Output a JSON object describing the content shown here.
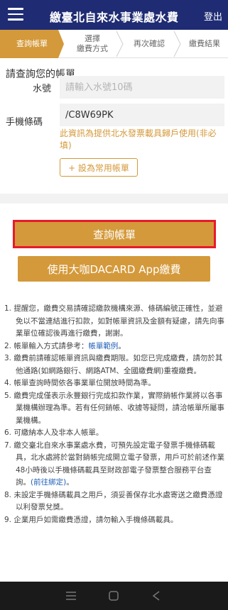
{
  "header": {
    "title": "繳臺北自來水事業處水費",
    "logout_label": "登出"
  },
  "steps": [
    {
      "label": "查詢帳單",
      "active": true
    },
    {
      "label": "選擇\n繳費方式",
      "active": false
    },
    {
      "label": "再次確認",
      "active": false
    },
    {
      "label": "繳費結果",
      "active": false
    }
  ],
  "form": {
    "section_title": "請查詢您的帳單",
    "water_no_label": "水號",
    "water_no_placeholder": "請輸入水號10碼",
    "water_no_value": "",
    "phone_barcode_label": "手機條碼",
    "phone_barcode_value": "/C8W69PK",
    "phone_barcode_note": "此資訊為提供北水發票載具歸戶使用(非必填)",
    "favorite_button_label": "+ 設為常用帳單"
  },
  "actions": {
    "query_label": "查詢帳單",
    "dacard_label": "使用大咖DACARD App繳費"
  },
  "notices": [
    {
      "text": "1. 提醒您，繳費交易請確認繳款機構來源、條碼編號正確性，並避免以不當連結進行扣款，如對帳單資訊及金額有疑慮，請先向事業單位確認後再進行繳費，謝謝。"
    },
    {
      "text": "2. 帳單輸入方式請參考：",
      "link": "帳單範例",
      "after": "。"
    },
    {
      "text": "3. 繳費前請確認帳單資訊與繳費期限。如您已完成繳費，請勿於其他通路(如網路銀行、網路ATM、全國繳費網)重複繳費。"
    },
    {
      "text": "4. 帳單查詢時間依各事業單位開放時間為準。"
    },
    {
      "text": "5. 繳費完成僅表示永豐銀行完成扣款作業，實際銷帳作業將以各事業機構辦理為準。若有任何銷帳、收據等疑問，請洽帳單所屬事業機構。"
    },
    {
      "text": "6. 可繳納本人及非本人帳單。"
    },
    {
      "text": "7. 繳交臺北自來水事業處水費，可預先設定電子發票手機條碼載具，北水處將於當對銷帳完成開立電子發票，用戶可於前述作業48小時後以手機條碼載具至財政部電子發票整合服務平台查詢。",
      "link": "(前往綁定)",
      "after": "。"
    },
    {
      "text": "8. 未設定手機條碼載具之用戶，須妥善保存北水處寄送之繳費憑證以利發票兌獎。"
    },
    {
      "text": "9. 企業用戶如需繳費憑證，請勿輸入手機條碼載具。"
    }
  ],
  "colors": {
    "header_bg": "#1f2c73",
    "accent": "#d4993a",
    "highlight_border": "#e8192c",
    "link": "#1f5fb8"
  }
}
